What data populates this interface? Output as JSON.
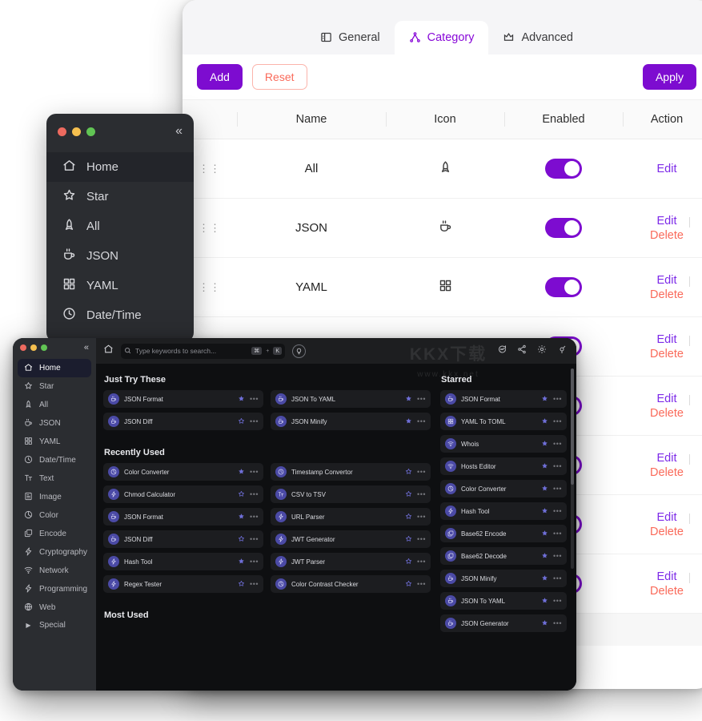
{
  "settings_window": {
    "tabs": [
      {
        "label": "General",
        "icon": "panel-left-icon",
        "active": false
      },
      {
        "label": "Category",
        "icon": "sitemap-icon",
        "active": true
      },
      {
        "label": "Advanced",
        "icon": "crown-icon",
        "active": false
      }
    ],
    "actions": {
      "add_label": "Add",
      "reset_label": "Reset",
      "apply_label": "Apply"
    },
    "table": {
      "columns": [
        "",
        "Name",
        "Icon",
        "Enabled",
        "Action"
      ],
      "edit_label": "Edit",
      "delete_label": "Delete",
      "rows": [
        {
          "name": "All",
          "icon": "rocket-icon",
          "enabled": true,
          "deletable": false
        },
        {
          "name": "JSON",
          "icon": "coffee-icon",
          "enabled": true,
          "deletable": true
        },
        {
          "name": "YAML",
          "icon": "grid-icon",
          "enabled": true,
          "deletable": true
        },
        {
          "name": "",
          "icon": "",
          "enabled": true,
          "deletable": true
        },
        {
          "name": "",
          "icon": "",
          "enabled": true,
          "deletable": true
        },
        {
          "name": "",
          "icon": "",
          "enabled": true,
          "deletable": true
        },
        {
          "name": "",
          "icon": "",
          "enabled": true,
          "deletable": true
        },
        {
          "name": "",
          "icon": "",
          "enabled": true,
          "deletable": true
        }
      ]
    },
    "colors": {
      "accent": "#7d0cd0",
      "danger": "#fa6a5a",
      "edit_link": "#7d2ae8"
    }
  },
  "mini_window": {
    "collapse_glyph": "«",
    "items": [
      {
        "label": "Home",
        "icon": "home-icon",
        "active": true
      },
      {
        "label": "Star",
        "icon": "star-icon",
        "active": false
      },
      {
        "label": "All",
        "icon": "rocket-icon",
        "active": false
      },
      {
        "label": "JSON",
        "icon": "coffee-icon",
        "active": false
      },
      {
        "label": "YAML",
        "icon": "grid-icon",
        "active": false
      },
      {
        "label": "Date/Time",
        "icon": "clock-icon",
        "active": false
      }
    ]
  },
  "app_window": {
    "collapse_glyph": "«",
    "sidebar": [
      {
        "label": "Home",
        "icon": "home-icon",
        "active": true,
        "expandable": false
      },
      {
        "label": "Star",
        "icon": "star-icon",
        "active": false,
        "expandable": false
      },
      {
        "label": "All",
        "icon": "rocket-icon",
        "active": false,
        "expandable": false
      },
      {
        "label": "JSON",
        "icon": "coffee-icon",
        "active": false,
        "expandable": false
      },
      {
        "label": "YAML",
        "icon": "grid-icon",
        "active": false,
        "expandable": false
      },
      {
        "label": "Date/Time",
        "icon": "clock-icon",
        "active": false,
        "expandable": false
      },
      {
        "label": "Text",
        "icon": "text-icon",
        "active": false,
        "expandable": false
      },
      {
        "label": "Image",
        "icon": "image-icon",
        "active": false,
        "expandable": false
      },
      {
        "label": "Color",
        "icon": "color-icon",
        "active": false,
        "expandable": false
      },
      {
        "label": "Encode",
        "icon": "encode-icon",
        "active": false,
        "expandable": false
      },
      {
        "label": "Cryptography",
        "icon": "bolt-icon",
        "active": false,
        "expandable": false
      },
      {
        "label": "Network",
        "icon": "wifi-icon",
        "active": false,
        "expandable": false
      },
      {
        "label": "Programming",
        "icon": "bolt-icon",
        "active": false,
        "expandable": false
      },
      {
        "label": "Web",
        "icon": "globe-icon",
        "active": false,
        "expandable": false
      },
      {
        "label": "Special",
        "icon": "caret-right-icon",
        "active": false,
        "expandable": true
      }
    ],
    "toolbar": {
      "home_icon": "home-icon",
      "search_placeholder": "Type keywords to search...",
      "shortcut_key1": "⌘",
      "shortcut_plus": "+",
      "shortcut_key2": "K",
      "bulb_icon": "lightbulb-icon",
      "right_icons": [
        "feedback-icon",
        "share-icon",
        "gear-icon",
        "pin-icon"
      ]
    },
    "watermark": {
      "cn": "KKX下载",
      "url": "www.kkx.net"
    },
    "sections": {
      "just_try_these": {
        "title": "Just Try These",
        "items": [
          {
            "label": "JSON Format",
            "icon": "coffee-icon",
            "starred": true
          },
          {
            "label": "JSON To YAML",
            "icon": "coffee-icon",
            "starred": true
          },
          {
            "label": "JSON Diff",
            "icon": "coffee-icon",
            "starred": false
          },
          {
            "label": "JSON Minify",
            "icon": "coffee-icon",
            "starred": true
          }
        ]
      },
      "recently_used": {
        "title": "Recently Used",
        "items": [
          {
            "label": "Color Converter",
            "icon": "color-icon",
            "starred": true
          },
          {
            "label": "Timestamp Convertor",
            "icon": "clock-icon",
            "starred": false
          },
          {
            "label": "Chmod Calculator",
            "icon": "bolt-icon",
            "starred": false
          },
          {
            "label": "CSV to TSV",
            "icon": "text-icon",
            "starred": false
          },
          {
            "label": "JSON Format",
            "icon": "coffee-icon",
            "starred": true
          },
          {
            "label": "URL Parser",
            "icon": "bolt-icon",
            "starred": false
          },
          {
            "label": "JSON Diff",
            "icon": "coffee-icon",
            "starred": false
          },
          {
            "label": "JWT Generator",
            "icon": "bolt-icon",
            "starred": false
          },
          {
            "label": "Hash Tool",
            "icon": "bolt-icon",
            "starred": true
          },
          {
            "label": "JWT Parser",
            "icon": "bolt-icon",
            "starred": false
          },
          {
            "label": "Regex Tester",
            "icon": "bolt-icon",
            "starred": false
          },
          {
            "label": "Color Contrast Checker",
            "icon": "color-icon",
            "starred": false
          }
        ]
      },
      "most_used": {
        "title": "Most Used",
        "items": []
      },
      "starred": {
        "title": "Starred",
        "items": [
          {
            "label": "JSON Format",
            "icon": "coffee-icon",
            "starred": true
          },
          {
            "label": "YAML To TOML",
            "icon": "grid-icon",
            "starred": true
          },
          {
            "label": "Whois",
            "icon": "wifi-icon",
            "starred": true
          },
          {
            "label": "Hosts Editor",
            "icon": "wifi-icon",
            "starred": true
          },
          {
            "label": "Color Converter",
            "icon": "color-icon",
            "starred": true
          },
          {
            "label": "Hash Tool",
            "icon": "bolt-icon",
            "starred": true
          },
          {
            "label": "Base62 Encode",
            "icon": "encode-icon",
            "starred": true
          },
          {
            "label": "Base62 Decode",
            "icon": "encode-icon",
            "starred": true
          },
          {
            "label": "JSON Minify",
            "icon": "coffee-icon",
            "starred": true
          },
          {
            "label": "JSON To YAML",
            "icon": "coffee-icon",
            "starred": true
          },
          {
            "label": "JSON Generator",
            "icon": "coffee-icon",
            "starred": true
          }
        ]
      }
    }
  }
}
